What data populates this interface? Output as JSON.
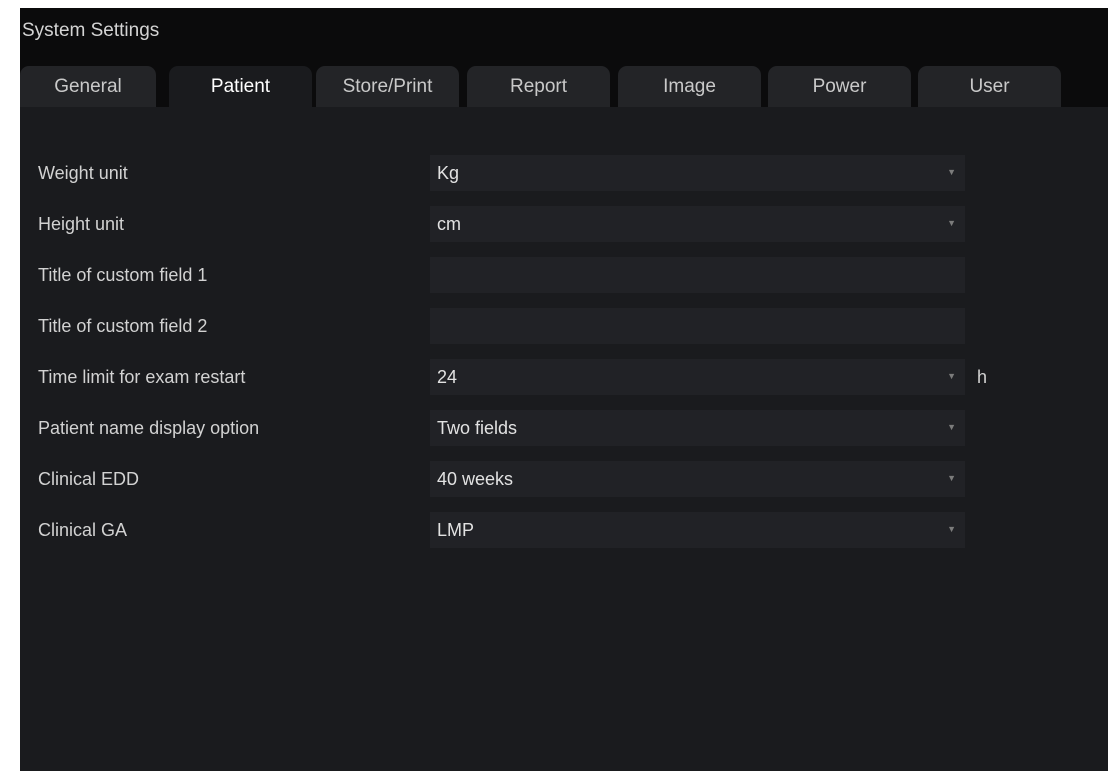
{
  "window": {
    "title": "System Settings"
  },
  "tabs": [
    {
      "label": "General",
      "active": false
    },
    {
      "label": "Patient",
      "active": true
    },
    {
      "label": "Store/Print",
      "active": false
    },
    {
      "label": "Report",
      "active": false
    },
    {
      "label": "Image",
      "active": false
    },
    {
      "label": "Power",
      "active": false
    },
    {
      "label": "User",
      "active": false
    }
  ],
  "settings": [
    {
      "label": "Weight unit",
      "value": "Kg",
      "control": "dropdown",
      "icon": "chevron-down-icon"
    },
    {
      "label": "Height unit",
      "value": "cm",
      "control": "dropdown",
      "icon": "chevron-down-icon"
    },
    {
      "label": "Title of custom field 1",
      "value": "",
      "control": "text-input"
    },
    {
      "label": "Title of custom field 2",
      "value": "",
      "control": "text-input"
    },
    {
      "label": "Time limit for exam restart",
      "value": "24",
      "unit": "h",
      "control": "dropdown",
      "icon": "chevron-down-icon"
    },
    {
      "label": "Patient name display option",
      "value": "Two fields",
      "control": "dropdown",
      "icon": "chevron-down-icon"
    },
    {
      "label": "Clinical EDD",
      "value": "40 weeks",
      "control": "dropdown",
      "icon": "chevron-down-icon"
    },
    {
      "label": "Clinical GA",
      "value": "LMP",
      "control": "dropdown",
      "icon": "chevron-down-icon"
    }
  ],
  "colors": {
    "window_background": "#0b0b0c",
    "panel_background": "#1a1b1e",
    "tab_inactive": "#232427",
    "field_background": "#212226",
    "text": "#d2d2d2"
  }
}
